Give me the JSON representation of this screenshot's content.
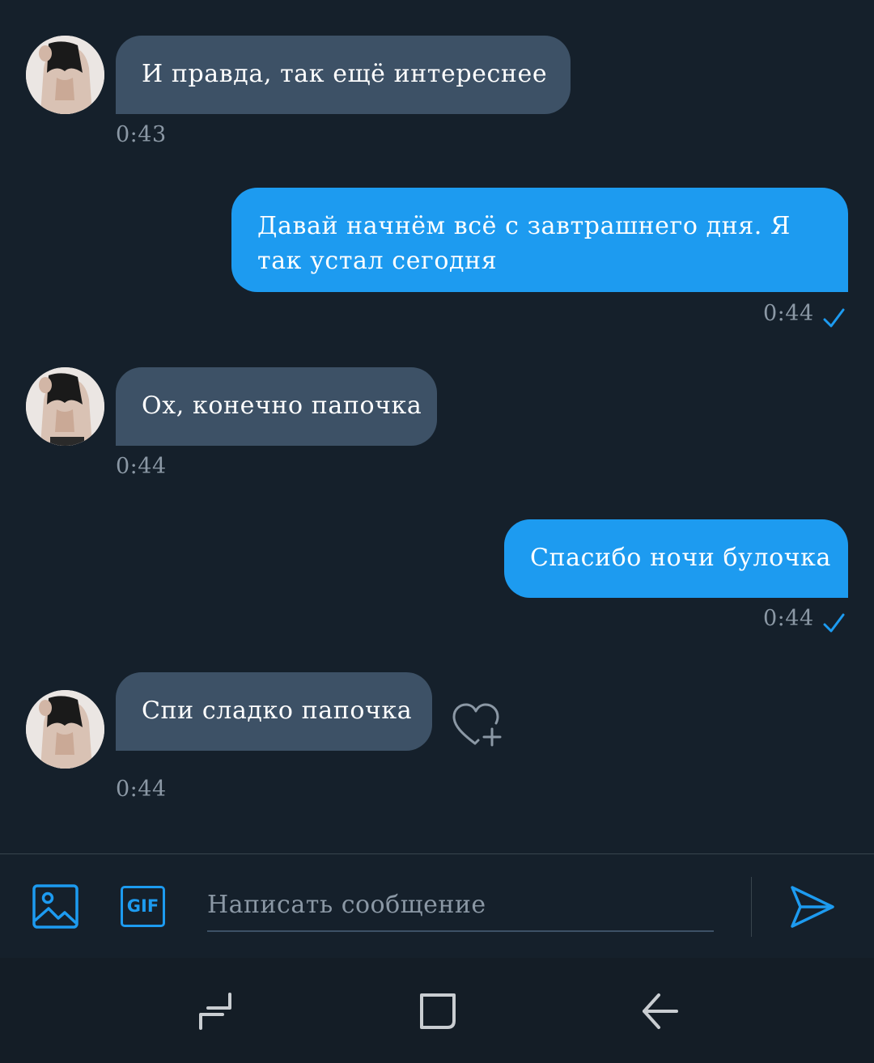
{
  "messages": [
    {
      "direction": "incoming",
      "text": "И правда, так ещё интереснее",
      "time": "0:43"
    },
    {
      "direction": "outgoing",
      "lines": [
        "Давай начнём всё с завтрашнего дня. Я",
        "так устал сегодня"
      ],
      "time": "0:44"
    },
    {
      "direction": "incoming",
      "text": "Ох, конечно папочка",
      "time": "0:44"
    },
    {
      "direction": "outgoing",
      "text": "Спасибо ночи булочка",
      "time": "0:44"
    },
    {
      "direction": "incoming",
      "text": "Спи сладко папочка",
      "time": "0:44"
    }
  ],
  "composer": {
    "gif_label": "GIF",
    "placeholder": "Написать сообщение",
    "value": ""
  },
  "icons": {
    "media": "image-icon",
    "gif": "gif-icon",
    "send": "send-icon",
    "reaction": "heart-plus-icon",
    "read_receipt": "checkmark-icon",
    "nav_recents": "recents-icon",
    "nav_home": "home-icon",
    "nav_back": "back-icon"
  },
  "colors": {
    "background": "#15202b",
    "incoming_bubble": "#3d5166",
    "outgoing_bubble": "#1d9bf0",
    "accent": "#1d9bf0",
    "timestamp": "#8b98a5"
  }
}
